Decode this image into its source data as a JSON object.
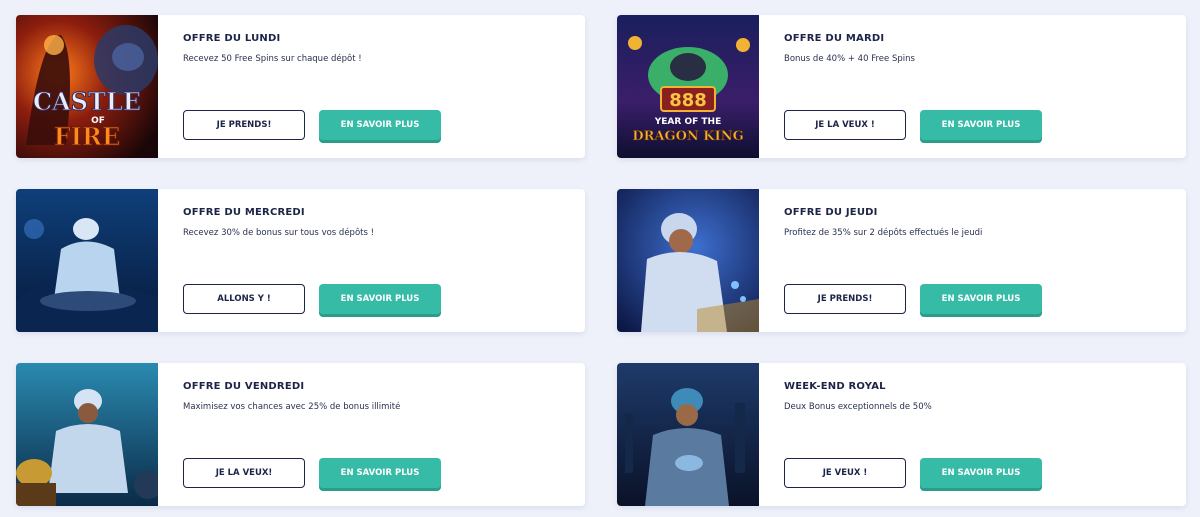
{
  "offers": [
    {
      "title": "OFFRE DU LUNDI",
      "description": "Recevez 50 Free Spins sur chaque dépôt !",
      "primary_label": "JE PRENDS!",
      "secondary_label": "EN SAVOIR PLUS",
      "image_text_1": "CASTLE",
      "image_text_2": "OF",
      "image_text_3": "FIRE"
    },
    {
      "title": "OFFRE DU MARDI",
      "description": "Bonus de 40% + 40 Free Spins",
      "primary_label": "JE LA VEUX !",
      "secondary_label": "EN SAVOIR PLUS",
      "image_text_1": "888",
      "image_text_2": "YEAR OF THE",
      "image_text_3": "DRAGON KING"
    },
    {
      "title": "OFFRE DU MERCREDI",
      "description": "Recevez 30% de bonus sur tous vos dépôts !",
      "primary_label": "ALLONS Y !",
      "secondary_label": "EN SAVOIR PLUS"
    },
    {
      "title": "OFFRE DU JEUDI",
      "description": "Profitez de 35% sur 2 dépôts effectués le jeudi",
      "primary_label": "JE PRENDS!",
      "secondary_label": "EN SAVOIR PLUS"
    },
    {
      "title": "OFFRE DU VENDREDI",
      "description": "Maximisez vos chances avec 25% de bonus illimité",
      "primary_label": "JE LA VEUX!",
      "secondary_label": "EN SAVOIR PLUS"
    },
    {
      "title": "WEEK-END ROYAL",
      "description": "Deux Bonus exceptionnels de 50%",
      "primary_label": "JE VEUX !",
      "secondary_label": "EN SAVOIR PLUS"
    }
  ],
  "colors": {
    "accent": "#35bba6",
    "text_dark": "#1c2447",
    "background": "#eef1fa"
  }
}
